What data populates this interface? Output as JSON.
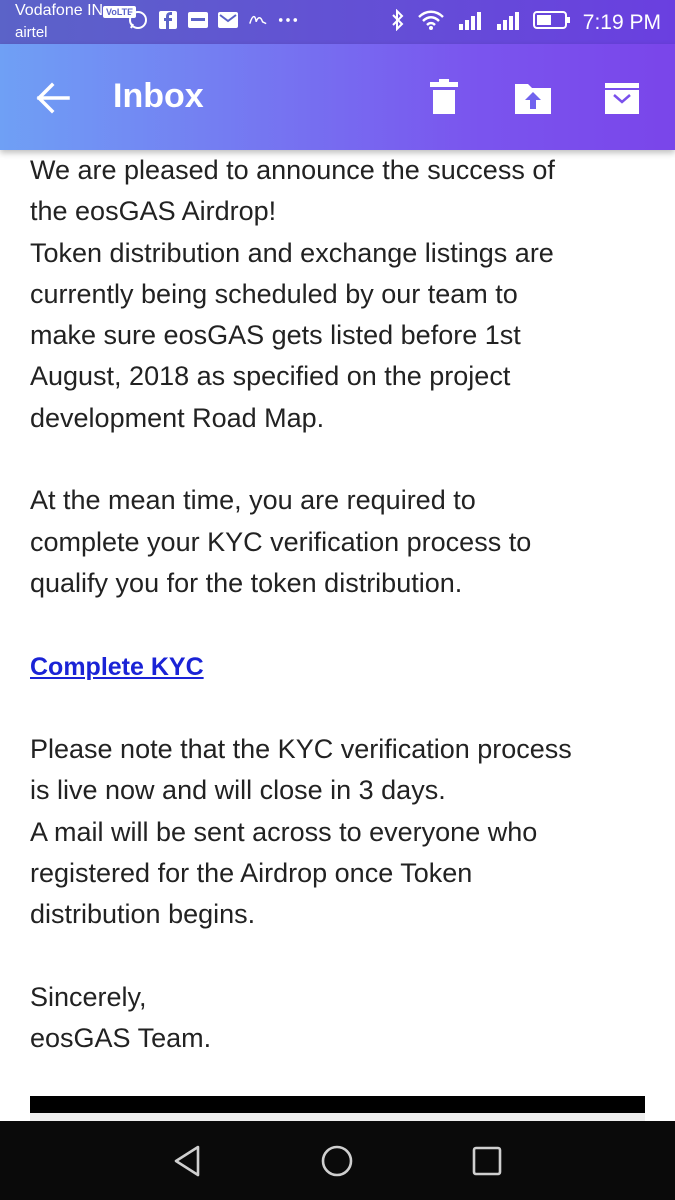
{
  "status_bar": {
    "carrier_primary": "Vodafone IN",
    "volte_badge": "VoLTE",
    "carrier_secondary": "airtel",
    "time": "7:19 PM"
  },
  "app_bar": {
    "title": "Inbox",
    "back_icon": "arrow-left-icon",
    "actions": [
      "delete-icon",
      "move-to-folder-icon",
      "archive-icon"
    ]
  },
  "email": {
    "paragraph1_lines": [
      "We are pleased to announce the success of",
      "the eosGAS Airdrop!",
      "Token distribution and exchange listings are",
      "currently being scheduled by our team to",
      "make sure eosGAS gets listed before 1st",
      "August, 2018 as specified on the project",
      "development Road Map."
    ],
    "paragraph2_lines": [
      "At the mean time, you are required to",
      "complete your KYC verification process to",
      "qualify you for the token distribution."
    ],
    "link_label": "Complete KYC",
    "paragraph3_lines": [
      "Please note that the KYC verification process",
      "is live now and will close in 3 days.",
      "A mail will be sent across to everyone who",
      "registered for the Airdrop once Token",
      "distribution begins."
    ],
    "signoff_lines": [
      "Sincerely,",
      "eosGAS Team."
    ]
  },
  "nav_bar": {
    "buttons": [
      "back-triangle-icon",
      "home-circle-icon",
      "recents-square-icon"
    ]
  },
  "colors": {
    "appbar_start": "#6fa0f5",
    "appbar_end": "#7a45ea",
    "link": "#1a23d6",
    "text": "#222222"
  }
}
